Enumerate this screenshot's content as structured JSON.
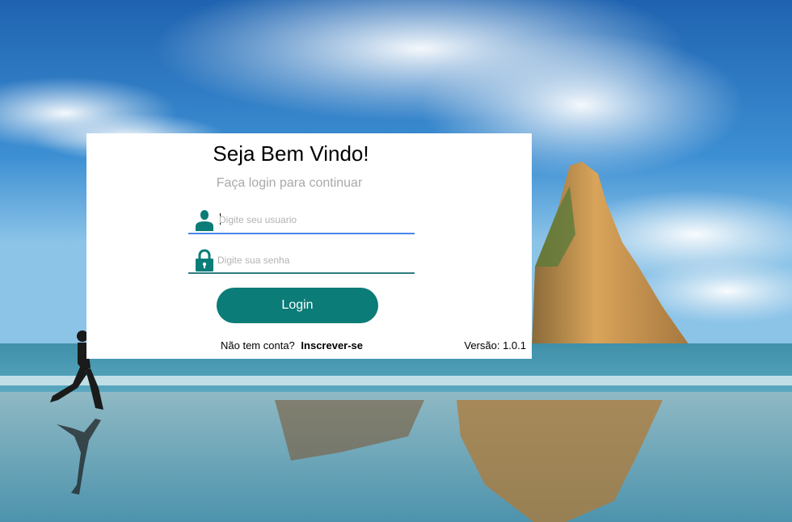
{
  "background": {
    "scene": "beach-with-runner-and-rock"
  },
  "login": {
    "title": "Seja Bem Vindo!",
    "subtitle": "Faça login para continuar",
    "username": {
      "placeholder": "Digite seu usuario",
      "value": "",
      "icon": "user-icon"
    },
    "password": {
      "placeholder": "Digite sua senha",
      "value": "",
      "icon": "lock-icon"
    },
    "button_label": "Login",
    "no_account_text": "Não tem conta?",
    "signup_link": "Inscrever-se",
    "version": "Versão: 1.0.1"
  },
  "colors": {
    "accent": "#0b7c77",
    "active_underline": "#4a86e8",
    "placeholder": "#b3b3b3",
    "subtitle": "#a9a9a9"
  }
}
